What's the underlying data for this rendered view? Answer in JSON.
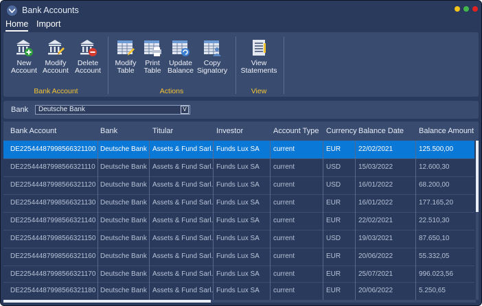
{
  "window": {
    "title": "Bank Accounts"
  },
  "window_controls": {
    "minimize_color": "#f2c31b",
    "maximize_color": "#43b84a",
    "close_color": "#e02222"
  },
  "menu": [
    {
      "label": "Home",
      "active": true
    },
    {
      "label": "Import",
      "active": false
    }
  ],
  "ribbon": {
    "groups": [
      {
        "label": "Bank Account",
        "buttons": [
          {
            "line1": "New",
            "line2": "Account",
            "icon": "bank-add-icon"
          },
          {
            "line1": "Modify",
            "line2": "Account",
            "icon": "bank-edit-icon"
          },
          {
            "line1": "Delete",
            "line2": "Account",
            "icon": "bank-delete-icon"
          }
        ]
      },
      {
        "label": "Actions",
        "buttons": [
          {
            "line1": "Modify",
            "line2": "Table",
            "icon": "table-edit-icon"
          },
          {
            "line1": "Print",
            "line2": "Table",
            "icon": "table-print-icon"
          },
          {
            "line1": "Update",
            "line2": "Balance",
            "icon": "table-refresh-icon"
          },
          {
            "line1": "Copy",
            "line2": "Signatory",
            "icon": "table-user-icon"
          }
        ]
      },
      {
        "label": "View",
        "buttons": [
          {
            "line1": "View",
            "line2": "Statements",
            "icon": "statements-icon"
          }
        ]
      }
    ]
  },
  "filter": {
    "label": "Bank",
    "value": "Deutsche Bank",
    "dropdown_glyph": "V"
  },
  "table": {
    "columns": [
      "Bank Account",
      "Bank",
      "Titular",
      "Investor",
      "Account Type",
      "Currency",
      "Balance Date",
      "Balance Amount"
    ],
    "rows": [
      [
        "DE22544487998566321100",
        "Deutsche Bank",
        "Assets & Fund Sarl.",
        "Funds Lux SA",
        "current",
        "EUR",
        "22/02/2021",
        "125.500,00"
      ],
      [
        "DE22544487998566321110",
        "Deutsche Bank",
        "Assets & Fund Sarl.",
        "Funds Lux SA",
        "current",
        "USD",
        "15/03/2022",
        "12.600,30"
      ],
      [
        "DE22544487998566321120",
        "Deutsche Bank",
        "Assets & Fund Sarl.",
        "Funds Lux SA",
        "current",
        "USD",
        "16/01/2022",
        "68.200,00"
      ],
      [
        "DE22544487998566321130",
        "Deutsche Bank",
        "Assets & Fund Sarl.",
        "Funds Lux SA",
        "current",
        "EUR",
        "16/01/2022",
        "177.165,20"
      ],
      [
        "DE22544487998566321140",
        "Deutsche Bank",
        "Assets & Fund Sarl.",
        "Funds Lux SA",
        "current",
        "EUR",
        "22/02/2021",
        "22.510,30"
      ],
      [
        "DE22544487998566321150",
        "Deutsche Bank",
        "Assets & Fund Sarl.",
        "Funds Lux SA",
        "current",
        "USD",
        "19/03/2021",
        "87.650,10"
      ],
      [
        "DE22544487998566321160",
        "Deutsche Bank",
        "Assets & Fund Sarl.",
        "Funds Lux SA",
        "current",
        "EUR",
        "20/06/2022",
        "55.332,05"
      ],
      [
        "DE22544487998566321170",
        "Deutsche Bank",
        "Assets & Fund Sarl.",
        "Funds Lux SA",
        "current",
        "EUR",
        "25/07/2021",
        "996.023,56"
      ],
      [
        "DE22544487998566321180",
        "Deutsche Bank",
        "Assets & Fund Sarl.",
        "Funds Lux SA",
        "current",
        "EUR",
        "20/06/2022",
        "5.250,65"
      ]
    ],
    "selected_row": 0
  },
  "colors": {
    "background": "#2a3a5c",
    "panel": "#3a4b70",
    "accent": "#f4c431",
    "selection": "#0a78d7"
  }
}
